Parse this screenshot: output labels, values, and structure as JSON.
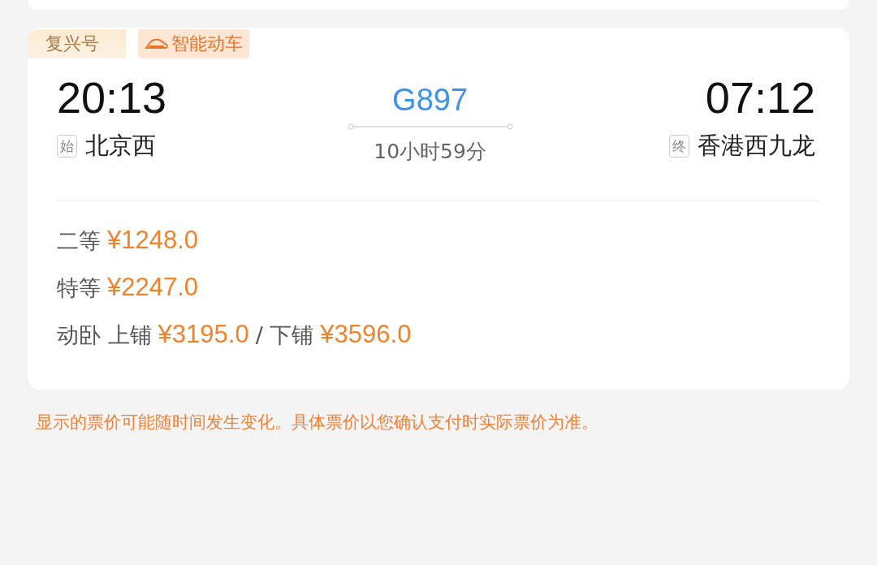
{
  "tags": [
    {
      "kind": "brand",
      "label": "复兴号"
    },
    {
      "kind": "feature",
      "label": "智能动车"
    }
  ],
  "departure": {
    "time": "20:13",
    "badge": "始",
    "station": "北京西"
  },
  "train": {
    "number": "G897",
    "duration": "10小时59分"
  },
  "arrival": {
    "time": "07:12",
    "badge": "终",
    "station": "香港西九龙"
  },
  "prices": [
    {
      "segments": [
        {
          "kind": "label",
          "text": "二等"
        },
        {
          "kind": "price",
          "text": "¥1248.0"
        }
      ]
    },
    {
      "segments": [
        {
          "kind": "label",
          "text": "特等"
        },
        {
          "kind": "price",
          "text": "¥2247.0"
        }
      ]
    },
    {
      "segments": [
        {
          "kind": "label",
          "text": "动卧 上铺"
        },
        {
          "kind": "price",
          "text": "¥3195.0"
        },
        {
          "kind": "label",
          "text": "/ 下铺"
        },
        {
          "kind": "price",
          "text": "¥3596.0"
        }
      ]
    }
  ],
  "notice": "显示的票价可能随时间发生变化。具体票价以您确认支付时实际票价为准。"
}
